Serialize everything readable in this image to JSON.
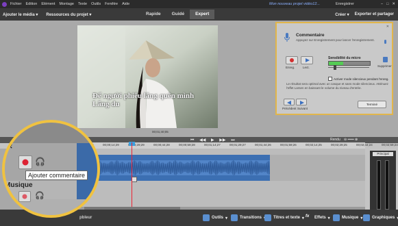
{
  "menubar": {
    "items": [
      "Fichier",
      "Edition",
      "Elément",
      "Montage",
      "Texte",
      "Outils",
      "Fenêtre",
      "Aide"
    ],
    "project_name": "Mon nouveau projet vidéo12...",
    "save_label": "Enregistrer"
  },
  "toolbar": {
    "add_media": "Ajouter le média",
    "project_assets": "Ressources du projet",
    "modes": [
      "Rapide",
      "Guidé",
      "Expert"
    ],
    "active_mode": "Expert",
    "create": "Créer",
    "export": "Exporter et partager"
  },
  "monitor": {
    "subtitle_line1": "Để người phiêu lãng quên mình",
    "subtitle_line2": "Lãng du",
    "timecode": "00;01;40;05"
  },
  "narration_panel": {
    "title": "Commentaire",
    "description": "Appuyez sur Enregistrement pour lancer l'enregistrement.",
    "record_label": "Enreg.",
    "play_label": "Lect.",
    "sensitivity_label": "Sensibilité du micro",
    "delete_label": "Supprimer",
    "checkbox_label": "Activer mode silencieux pendant l'enreg.",
    "note": "Le résultat sera optimal avec un casque et sans mode silencieux. Atténuez l'effet Larsen en baissant le volume du niveau d'entrée.",
    "prev_label": "Précédent",
    "next_label": "Suivant",
    "done_label": "Terminé"
  },
  "timeline": {
    "render_label": "Rendu",
    "ruler_ticks": [
      "00;00;00;00",
      "00;00;14;29",
      "00;00;29;29",
      "00;00;44;28",
      "00;00;59;28",
      "00;01;14;27",
      "00;01;29;27",
      "00;01;44;26",
      "00;01;59;26",
      "00;02;14;25",
      "00;02;29;25",
      "00;02;44;24",
      "00;02;59;24"
    ],
    "vu_label": "Principal"
  },
  "magnifier": {
    "tooltip": "Ajouter commentaire",
    "track_label": "Musique"
  },
  "bottombar": {
    "tools": [
      "Outils",
      "Transitions",
      "Titres et texte",
      "Effets",
      "Musique",
      "Graphiques"
    ],
    "left_partial": "pbleur"
  },
  "colors": {
    "accent_highlight": "#f0c240",
    "record_red": "#d23030",
    "clip_blue": "#3c6fb2",
    "playhead": "#e02030"
  }
}
